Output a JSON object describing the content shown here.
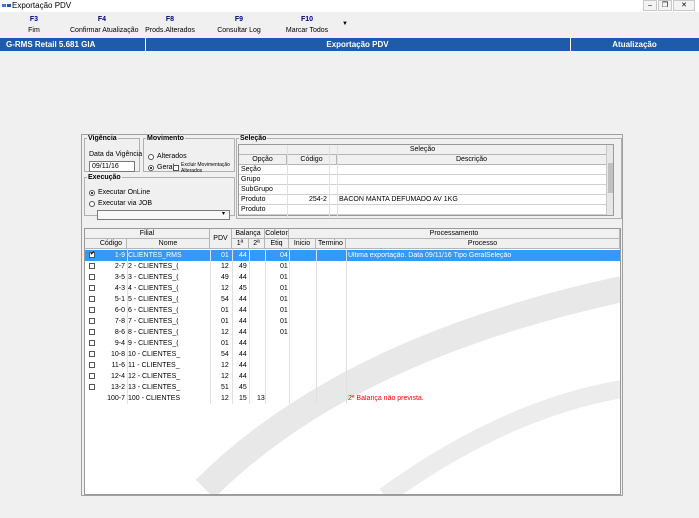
{
  "window": {
    "title": "Exportação PDV"
  },
  "toolbar": {
    "items": [
      {
        "key": "F3",
        "label": "Fim"
      },
      {
        "key": "F4",
        "label": "Confirmar Atualização"
      },
      {
        "key": "F8",
        "label": "Prods.Alterados"
      },
      {
        "key": "F9",
        "label": "Consultar Log"
      },
      {
        "key": "F10",
        "label": "Marcar Todos"
      }
    ],
    "more": "▼"
  },
  "header": {
    "left": "G-RMS Retail 5.681 GIA",
    "center": "Exportação PDV",
    "right": "Atualização"
  },
  "vigencia": {
    "legend": "Vigência",
    "label": "Data da Vigência",
    "value": "09/11/16"
  },
  "movimento": {
    "legend": "Movimento",
    "opt_alterados": "Alterados",
    "opt_geral": "Geral",
    "excluir": "Excluir Movimentação Alterados"
  },
  "execucao": {
    "legend": "Execução",
    "opt_online": "Executar OnLine",
    "opt_job": "Executar via JOB",
    "job_value": ""
  },
  "selecao": {
    "legend": "Seleção",
    "grid_title": "Seleção",
    "col_opcao": "Opção",
    "col_codigo": "Código",
    "col_descricao": "Descrição",
    "rows": [
      {
        "opcao": "Seção",
        "codigo": "",
        "descricao": ""
      },
      {
        "opcao": "Grupo",
        "codigo": "",
        "descricao": ""
      },
      {
        "opcao": "SubGrupo",
        "codigo": "",
        "descricao": ""
      },
      {
        "opcao": "Produto",
        "codigo": "254-2",
        "descricao": "BACON MANTA DEFUMADO        AV  1KG"
      },
      {
        "opcao": "Produto",
        "codigo": "",
        "descricao": ""
      }
    ]
  },
  "grid": {
    "h_filial": "Filial",
    "h_codigo": "Código",
    "h_nome": "Nome",
    "h_pdv": "PDV",
    "h_balanca": "Balança",
    "h_b1": "1ª",
    "h_b2": "2ª",
    "h_coletor": "Coletor",
    "h_etiq": "Etiq",
    "h_processamento": "Processamento",
    "h_inicio": "Inicio",
    "h_termino": "Termino",
    "h_processo": "Processo",
    "rows": [
      {
        "checkbox": true,
        "codigo": "1-9",
        "nome": "CLIENTES_RMS",
        "pdv": "01",
        "b1": "44",
        "b2": "",
        "etiq": "04",
        "processo": "Última exportação. Data 09/11/16 Tipo GeralSeleção",
        "selected": true
      },
      {
        "checkbox": true,
        "codigo": "2-7",
        "nome": "2 - CLIENTES_(",
        "pdv": "12",
        "b1": "49",
        "b2": "",
        "etiq": "01",
        "processo": ""
      },
      {
        "checkbox": true,
        "codigo": "3-5",
        "nome": "3 - CLIENTES_(",
        "pdv": "49",
        "b1": "44",
        "b2": "",
        "etiq": "01",
        "processo": ""
      },
      {
        "checkbox": true,
        "codigo": "4-3",
        "nome": "4 - CLIENTES_(",
        "pdv": "12",
        "b1": "45",
        "b2": "",
        "etiq": "01",
        "processo": ""
      },
      {
        "checkbox": true,
        "codigo": "5-1",
        "nome": "5 - CLIENTES_(",
        "pdv": "54",
        "b1": "44",
        "b2": "",
        "etiq": "01",
        "processo": ""
      },
      {
        "checkbox": true,
        "codigo": "6-0",
        "nome": "6 - CLIENTES_(",
        "pdv": "01",
        "b1": "44",
        "b2": "",
        "etiq": "01",
        "processo": ""
      },
      {
        "checkbox": true,
        "codigo": "7-8",
        "nome": "7 - CLIENTES_(",
        "pdv": "01",
        "b1": "44",
        "b2": "",
        "etiq": "01",
        "processo": ""
      },
      {
        "checkbox": true,
        "codigo": "8-6",
        "nome": "8 - CLIENTES_(",
        "pdv": "12",
        "b1": "44",
        "b2": "",
        "etiq": "01",
        "processo": ""
      },
      {
        "checkbox": true,
        "codigo": "9-4",
        "nome": "9 - CLIENTES_(",
        "pdv": "01",
        "b1": "44",
        "b2": "",
        "etiq": "",
        "processo": ""
      },
      {
        "checkbox": true,
        "codigo": "10-8",
        "nome": "10 - CLIENTES_",
        "pdv": "54",
        "b1": "44",
        "b2": "",
        "etiq": "",
        "processo": ""
      },
      {
        "checkbox": true,
        "codigo": "11-6",
        "nome": "11 - CLIENTES_",
        "pdv": "12",
        "b1": "44",
        "b2": "",
        "etiq": "",
        "processo": ""
      },
      {
        "checkbox": true,
        "codigo": "12-4",
        "nome": "12 - CLIENTES_",
        "pdv": "12",
        "b1": "44",
        "b2": "",
        "etiq": "",
        "processo": ""
      },
      {
        "checkbox": true,
        "codigo": "13-2",
        "nome": "13 - CLIENTES_",
        "pdv": "51",
        "b1": "45",
        "b2": "",
        "etiq": "",
        "processo": ""
      },
      {
        "checkbox": false,
        "codigo": "100-7",
        "nome": "100 - CLIENTES",
        "pdv": "12",
        "b1": "15",
        "b2": "13",
        "etiq": "",
        "processo": "2ª Balança não prevista.",
        "error": true
      }
    ]
  },
  "colors": {
    "accent": "#1e5ba8",
    "selection": "#3399ff",
    "error": "#ff0000",
    "toolbar_key": "#000080"
  }
}
